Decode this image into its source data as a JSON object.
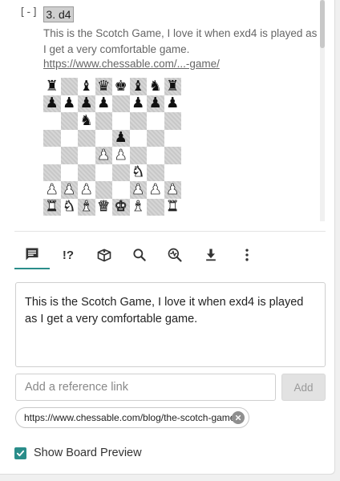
{
  "annotation": {
    "collapse_label": "[-]",
    "move": "3. d4",
    "comment": "This is the Scotch Game, I love it when exd4 is played as I get a very comfortable game.",
    "link_text": "https://www.chessable.com/...-game/"
  },
  "board": {
    "rows": [
      [
        "br",
        "",
        "bb",
        "bq",
        "bk",
        "bb",
        "bn",
        "br"
      ],
      [
        "bp",
        "bp",
        "bp",
        "bp",
        "",
        "bp",
        "bp",
        "bp"
      ],
      [
        "",
        "",
        "bn",
        "",
        "",
        "",
        "",
        ""
      ],
      [
        "",
        "",
        "",
        "",
        "bp",
        "",
        "",
        ""
      ],
      [
        "",
        "",
        "",
        "wp",
        "wp",
        "",
        "",
        ""
      ],
      [
        "",
        "",
        "",
        "",
        "",
        "wn",
        "",
        ""
      ],
      [
        "wp",
        "wp",
        "wp",
        "",
        "",
        "wp",
        "wp",
        "wp"
      ],
      [
        "wr",
        "wn",
        "wb",
        "wq",
        "wk",
        "wb",
        "",
        "wr"
      ]
    ]
  },
  "toolbar": {
    "items": [
      {
        "name": "comment-icon",
        "active": true
      },
      {
        "name": "annotation-symbol-icon",
        "label": "!?"
      },
      {
        "name": "lesson-book-icon"
      },
      {
        "name": "search-icon"
      },
      {
        "name": "engine-analysis-icon"
      },
      {
        "name": "download-icon"
      },
      {
        "name": "more-vertical-icon"
      }
    ],
    "accent_color": "#2a8d8a"
  },
  "editor": {
    "comment_value": "This is the Scotch Game, I love it when exd4 is played as I get a very comfortable game.",
    "reference_placeholder": "Add a reference link",
    "add_label": "Add",
    "chip_url": "https://www.chessable.com/blog/the-scotch-game/",
    "show_preview_label": "Show Board Preview",
    "show_preview_checked": true
  }
}
